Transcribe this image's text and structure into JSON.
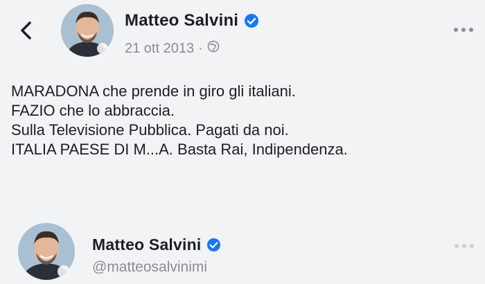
{
  "post": {
    "author": "Matteo Salvini",
    "date": "21 ott 2013",
    "separator": "·",
    "privacy_icon": "globe-icon",
    "text_lines": [
      "MARADONA che prende in giro gli italiani.",
      "FAZIO che lo abbraccia.",
      "Sulla Televisione Pubblica. Pagati da noi.",
      "ITALIA PAESE DI M...A. Basta Rai, Indipendenza."
    ]
  },
  "profile_card": {
    "name": "Matteo Salvini",
    "handle": "@matteosalvinimi"
  },
  "colors": {
    "background": "#f2f3f5",
    "verified_badge": "#1877f2",
    "secondary_text": "#8a8d91"
  }
}
